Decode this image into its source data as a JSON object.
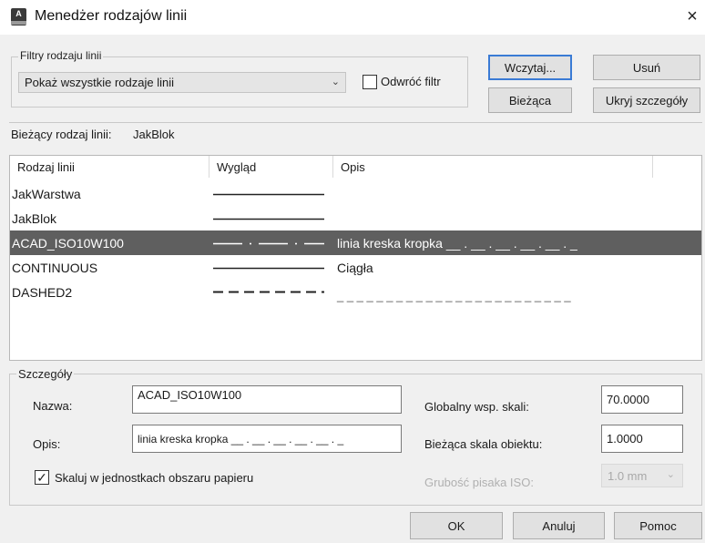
{
  "window": {
    "title": "Menedżer rodzajów linii",
    "close_glyph": "×",
    "icon_letter": "A"
  },
  "filters": {
    "legend": "Filtry rodzaju linii",
    "selected": "Pokaż wszystkie rodzaje linii",
    "invert_label": "Odwróć filtr",
    "invert_checked": false
  },
  "buttons": {
    "load": "Wczytaj...",
    "delete": "Usuń",
    "current": "Bieżąca",
    "hide_details": "Ukryj szczegóły",
    "ok": "OK",
    "cancel": "Anuluj",
    "help": "Pomoc"
  },
  "current_linetype": {
    "label": "Bieżący rodzaj linii:",
    "value": "JakBlok"
  },
  "list": {
    "columns": [
      "Rodzaj linii",
      "Wygląd",
      "Opis"
    ],
    "rows": [
      {
        "name": "JakWarstwa",
        "appearance": "solid",
        "description": "",
        "selected": false
      },
      {
        "name": "JakBlok",
        "appearance": "solid",
        "description": "",
        "selected": false
      },
      {
        "name": "ACAD_ISO10W100",
        "appearance": "dashdot",
        "description": "linia kreska kropka __ . __ . __ . __ . __ . _",
        "selected": true
      },
      {
        "name": "CONTINUOUS",
        "appearance": "solid",
        "description": "Ciągła",
        "selected": false
      },
      {
        "name": "DASHED2",
        "appearance": "dashed",
        "description": "_ _ _ _ _ _ _ _ _ _ _ _ _ _ _ _ _ _ _ _ _ _ _ _",
        "selected": false
      }
    ]
  },
  "details": {
    "legend": "Szczegóły",
    "name_label": "Nazwa:",
    "name_value": "ACAD_ISO10W100",
    "desc_label": "Opis:",
    "desc_value": "linia kreska kropka __ . __ . __ . __ . __ . _",
    "global_scale_label": "Globalny wsp. skali:",
    "global_scale_value": "70.0000",
    "object_scale_label": "Bieżąca skala obiektu:",
    "object_scale_value": "1.0000",
    "pen_label": "Grubość pisaka ISO:",
    "pen_value": "1.0 mm",
    "paperspace_label": "Skaluj w jednostkach obszaru papieru",
    "paperspace_checked": true
  }
}
